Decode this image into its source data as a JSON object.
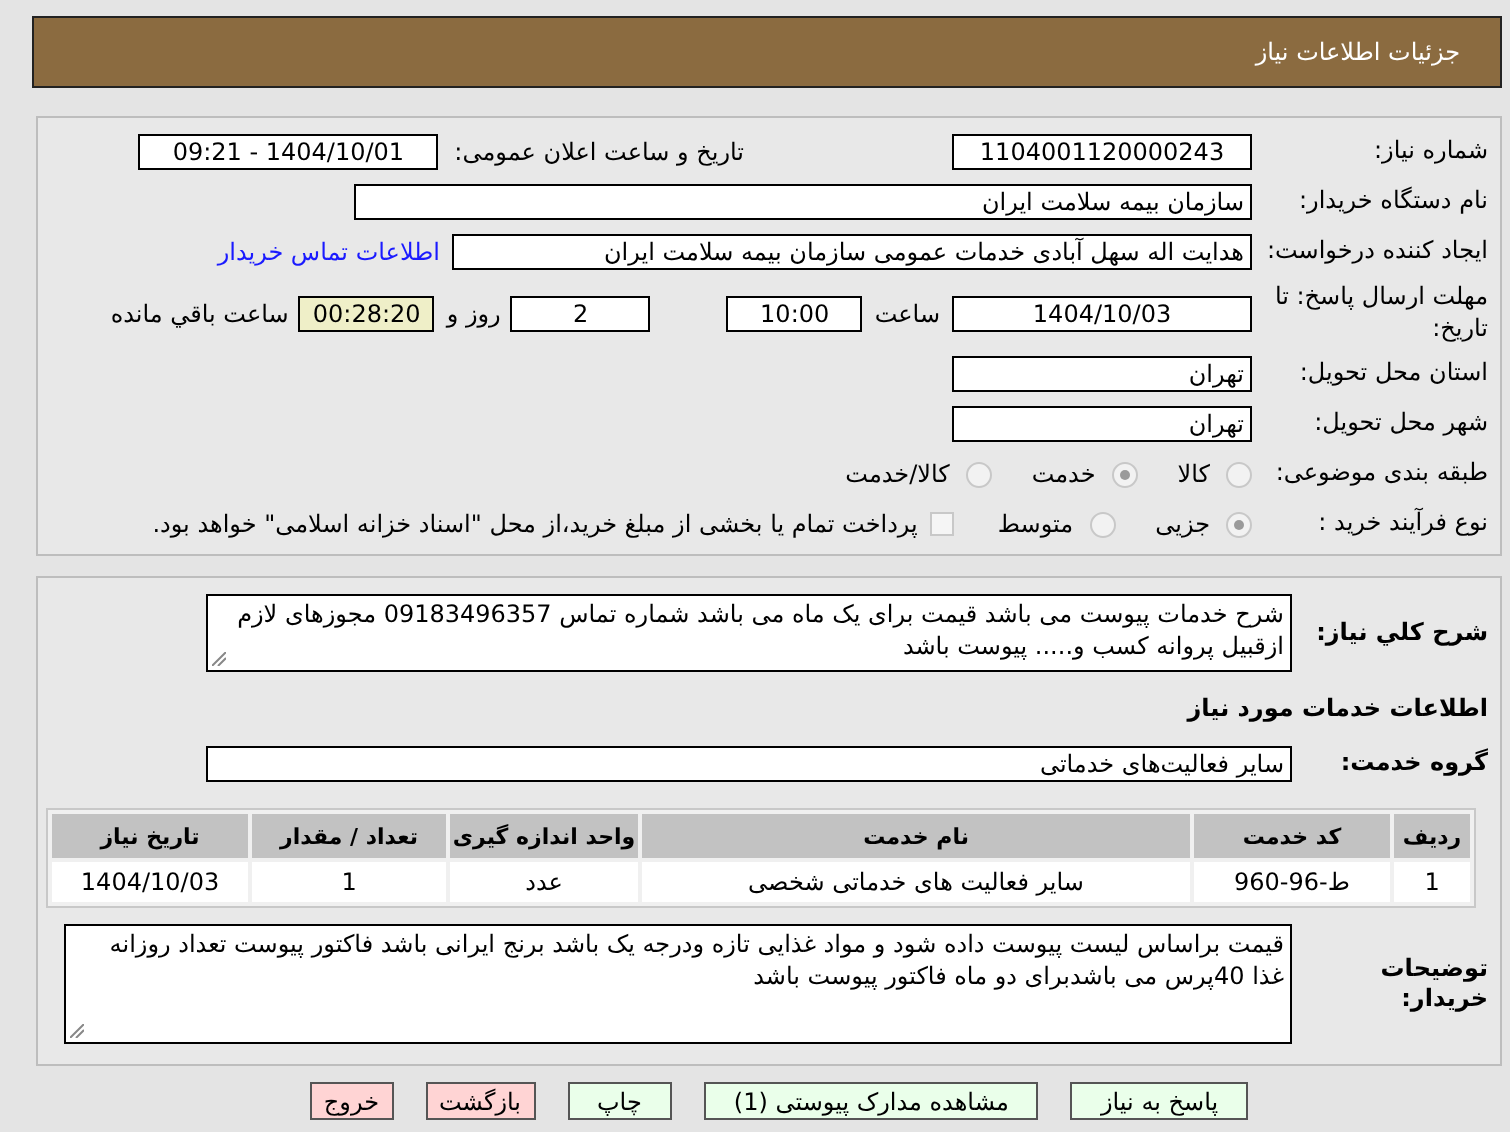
{
  "header": {
    "title": "جزئیات اطلاعات نیاز"
  },
  "details": {
    "need_number": {
      "label": "شماره نیاز:",
      "value": "1104001120000243"
    },
    "announce": {
      "label": "تاریخ و ساعت اعلان عمومی:",
      "value": "1404/10/01 - 09:21"
    },
    "buyer_org": {
      "label": "نام دستگاه خریدار:",
      "value": "سازمان بیمه سلامت ایران"
    },
    "requester": {
      "label": "ایجاد کننده درخواست:",
      "value": "هدایت اله سهل آبادی خدمات عمومی سازمان بیمه سلامت ایران",
      "link": "اطلاعات تماس خریدار"
    },
    "deadline": {
      "label": "مهلت ارسال پاسخ: تا تاریخ:",
      "date": "1404/10/03",
      "time_label": "ساعت",
      "time": "10:00",
      "days": "2",
      "days_label": "روز و",
      "remaining": "00:28:20",
      "remaining_label": "ساعت باقي مانده"
    },
    "province": {
      "label": "استان محل تحویل:",
      "value": "تهران"
    },
    "city": {
      "label": "شهر محل تحویل:",
      "value": "تهران"
    },
    "category": {
      "label": "طبقه بندی موضوعی:",
      "options": [
        {
          "label": "کالا",
          "selected": false
        },
        {
          "label": "خدمت",
          "selected": true
        },
        {
          "label": "کالا/خدمت",
          "selected": false
        }
      ]
    },
    "purchase_type": {
      "label": "نوع فرآیند خرید :",
      "options": [
        {
          "label": "جزیی",
          "selected": true
        },
        {
          "label": "متوسط",
          "selected": false
        }
      ],
      "treasury": {
        "checked": false,
        "text": "پرداخت تمام یا بخشی از مبلغ خرید،از محل \"اسناد خزانه اسلامی\" خواهد بود."
      }
    }
  },
  "need": {
    "description_label": "شرح کلي نیاز:",
    "description": "شرح خدمات پیوست می باشد قیمت برای یک ماه می باشد شماره تماس 09183496357 مجوزهای لازم ازقبیل پروانه کسب و..... پیوست باشد",
    "services_title": "اطلاعات خدمات مورد نیاز",
    "group_label": "گروه خدمت:",
    "group": "سایر فعالیت‌های خدماتی",
    "table": {
      "columns": [
        "ردیف",
        "کد خدمت",
        "نام خدمت",
        "واحد اندازه گیری",
        "تعداد / مقدار",
        "تاریخ نیاز"
      ],
      "rows": [
        [
          "1",
          "ط-96-960",
          "سایر فعالیت های خدماتی شخصی",
          "عدد",
          "1",
          "1404/10/03"
        ]
      ]
    },
    "notes_label": "توضیحات خریدار:",
    "notes": "قیمت براساس لیست پیوست  داده شود و مواد غذایی تازه ودرجه یک باشد برنج ایرانی باشد فاکتور پیوست تعداد روزانه غذا 40پرس می باشدبرای  دو ماه فاکتور پیوست باشد"
  },
  "buttons": [
    {
      "label": "پاسخ به نیاز",
      "kind": "action"
    },
    {
      "label": "مشاهده مدارک پیوستی (1)",
      "kind": "action"
    },
    {
      "label": "چاپ",
      "kind": "action"
    },
    {
      "label": "بازگشت",
      "kind": "exit"
    },
    {
      "label": "خروج",
      "kind": "exit"
    }
  ]
}
